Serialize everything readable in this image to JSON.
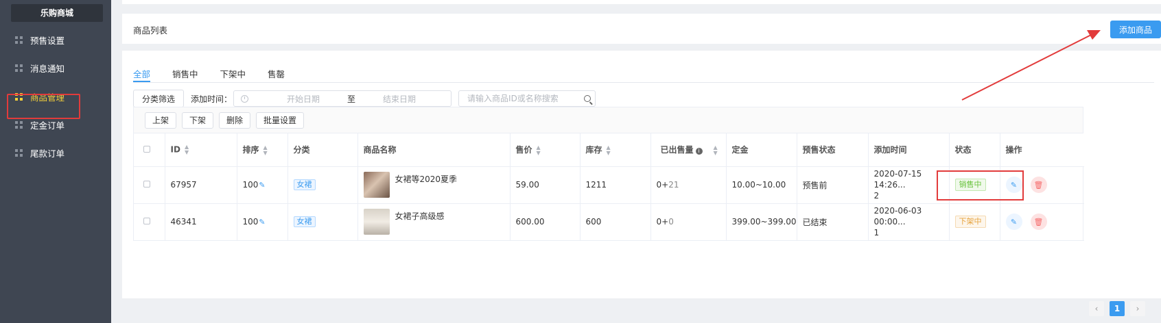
{
  "sidebar": {
    "brand": "乐购商城",
    "items": [
      {
        "label": "预售设置"
      },
      {
        "label": "消息通知"
      },
      {
        "label": "商品管理"
      },
      {
        "label": "定金订单"
      },
      {
        "label": "尾款订单"
      }
    ]
  },
  "header": {
    "title": "商品列表",
    "add_button": "添加商品"
  },
  "tabs": [
    "全部",
    "销售中",
    "下架中",
    "售罄"
  ],
  "filter": {
    "category_button": "分类筛选",
    "time_label": "添加时间：",
    "start_placeholder": "开始日期",
    "separator": "至",
    "end_placeholder": "结束日期",
    "search_placeholder": "请输入商品ID或名称搜索"
  },
  "actions": [
    "上架",
    "下架",
    "删除",
    "批量设置"
  ],
  "table": {
    "headers": [
      "ID",
      "排序",
      "分类",
      "商品名称",
      "售价",
      "库存",
      "已出售量",
      "定金",
      "预售状态",
      "添加时间",
      "状态",
      "操作"
    ],
    "rows": [
      {
        "id": "67957",
        "sort": "100",
        "category": "女裙",
        "name": "女裙等2020夏季",
        "price": "59.00",
        "stock": "1211",
        "sold_base": "0+",
        "sold_extra": "21",
        "deposit": "10.00~10.00",
        "presale_status": "预售前",
        "time_line1": "2020-07-15 14:26...",
        "time_line2": "2",
        "status": "销售中"
      },
      {
        "id": "46341",
        "sort": "100",
        "category": "女裙",
        "name": "女裙子高级感",
        "price": "600.00",
        "stock": "600",
        "sold_base": "0+",
        "sold_extra": "0",
        "deposit": "399.00~399.00",
        "presale_status": "已结束",
        "time_line1": "2020-06-03 00:00...",
        "time_line2": "1",
        "status": "下架中"
      }
    ]
  },
  "pager": {
    "prev": "‹",
    "current": "1",
    "next": "›"
  },
  "colors": {
    "accent": "#3a9bf0",
    "sidebar_bg": "#3f4652",
    "annotation_red": "#e23b3b",
    "active_nav": "#f5d03a"
  }
}
